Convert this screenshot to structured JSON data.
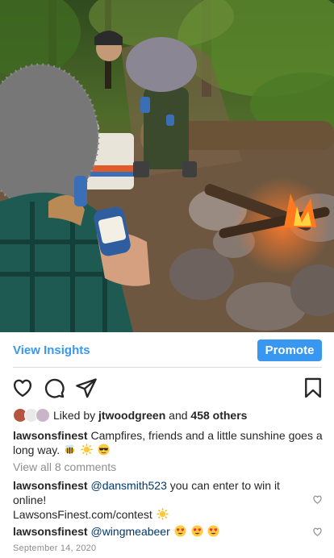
{
  "post": {
    "photo_alt": "",
    "insights_label": "View Insights",
    "promote_label": "Promote",
    "actions": {
      "like_icon": "heart-icon",
      "comment_icon": "comment-icon",
      "share_icon": "send-icon",
      "save_icon": "bookmark-icon"
    },
    "likes": {
      "prefix": "Liked by",
      "first_liker": "jtwoodgreen",
      "connector": "and",
      "others": "458 others"
    },
    "caption": {
      "username": "lawsonsfinest",
      "text": "Campfires, friends and a little sunshine goes a long way.",
      "emojis": [
        "bee",
        "sun",
        "sunglasses-face"
      ]
    },
    "view_all_comments": "View all 8 comments",
    "comments": [
      {
        "username": "lawsonsfinest",
        "mention": "@dansmith523",
        "text": "you can enter to win it online!",
        "line2": "LawsonsFinest.com/contest",
        "emojis": [
          "sun"
        ]
      },
      {
        "username": "lawsonsfinest",
        "mention": "@wingmeabeer",
        "text": "",
        "emojis": [
          "heart-eyes",
          "heart-eyes",
          "heart-eyes"
        ]
      }
    ],
    "date": "September 14, 2020"
  },
  "colors": {
    "accent": "#3897f0",
    "text": "#262626",
    "muted": "#8e8e8e",
    "mention": "#00376b"
  }
}
